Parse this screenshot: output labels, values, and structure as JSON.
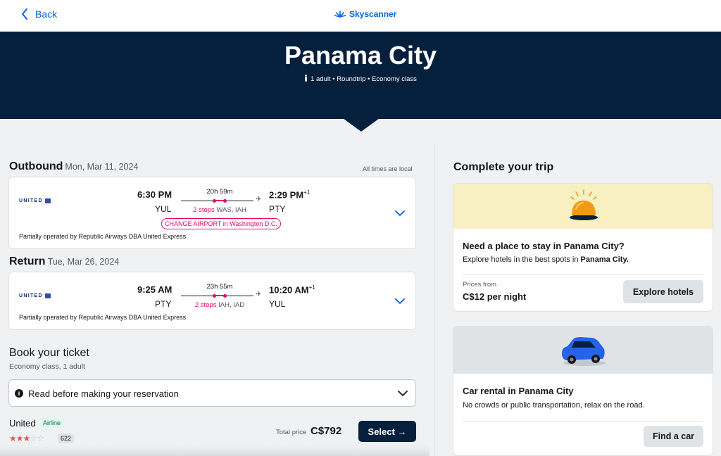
{
  "topbar": {
    "back_label": "Back",
    "brand": "Skyscanner"
  },
  "hero": {
    "title": "Panama City",
    "subtitle": "1 adult • Roundtrip • Economy class"
  },
  "outbound": {
    "heading": "Outbound",
    "date": "Mon, Mar 11, 2024",
    "times_note": "All times are local",
    "airline": "UNITED",
    "dep_time": "6:30 PM",
    "dep_code": "YUL",
    "duration": "20h 59m",
    "stops_count": "2 stops",
    "stops_airports": "WAS, IAH",
    "arr_time": "2:29 PM",
    "arr_day_offset": "+1",
    "arr_code": "PTY",
    "warning": "CHANGE AIRPORT in Washington D.C.",
    "operated_by": "Partially operated by Republic Airways DBA United Express"
  },
  "return": {
    "heading": "Return",
    "date": "Tue, Mar 26, 2024",
    "airline": "UNITED",
    "dep_time": "9:25 AM",
    "dep_code": "PTY",
    "duration": "23h 55m",
    "stops_count": "2 stops",
    "stops_airports": "IAH, IAD",
    "arr_time": "10:20 AM",
    "arr_day_offset": "+1",
    "arr_code": "YUL",
    "operated_by": "Partially operated by Republic Airways DBA United Express"
  },
  "booking": {
    "title": "Book your ticket",
    "subtitle": "Economy class, 1 adult",
    "notice": "Read before making your reservation",
    "vendor_name": "United",
    "vendor_type": "Airline",
    "rating_stars": 3,
    "rating_max": 5,
    "review_count": "622",
    "total_label": "Total price",
    "total_price": "C$792",
    "select_label": "Select →"
  },
  "complete_trip": {
    "title": "Complete your trip",
    "hotels": {
      "heading": "Need a place to stay in Panama City?",
      "desc_prefix": "Explore hotels in the best spots in ",
      "desc_city": "Panama City.",
      "prices_from": "Prices from",
      "price": "C$12 per night",
      "button": "Explore hotels",
      "banner_color": "#f9f0c2"
    },
    "cars": {
      "heading": "Car rental in Panama City",
      "desc": "No crowds or public transportation, relax on the road.",
      "button": "Find a car",
      "banner_color": "#e0e3e5"
    }
  },
  "colors": {
    "brand_blue": "#0062e3",
    "navy": "#05203c",
    "stop_red": "#e70866",
    "star": "#e0554e"
  }
}
